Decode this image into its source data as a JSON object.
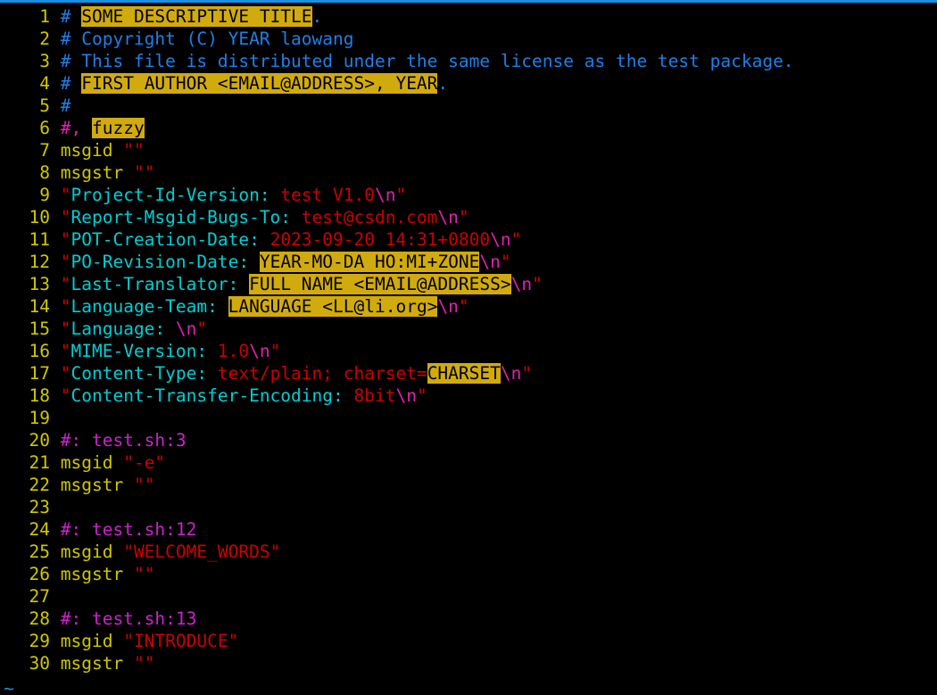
{
  "editor": {
    "name": "vim",
    "mode": "normal",
    "filetype": "po",
    "background_color": "#000000",
    "border_color": "#1a8fe3",
    "search_highlight_color": "#d1ab0e",
    "line_number_color": "#cfc800",
    "filler_char": "~"
  },
  "lines": [
    {
      "num": "1",
      "segments": [
        {
          "text": "#",
          "cls": "c-hash"
        },
        {
          "text": " ",
          "cls": "c-comment"
        },
        {
          "text": "SOME DESCRIPTIVE TITLE",
          "cls": "hl"
        },
        {
          "text": ".",
          "cls": "c-comment"
        }
      ]
    },
    {
      "num": "2",
      "segments": [
        {
          "text": "# Copyright (C) YEAR laowang",
          "cls": "c-comment"
        }
      ]
    },
    {
      "num": "3",
      "segments": [
        {
          "text": "# This file is distributed under the same license as the test package.",
          "cls": "c-comment"
        }
      ]
    },
    {
      "num": "4",
      "segments": [
        {
          "text": "#",
          "cls": "c-hash"
        },
        {
          "text": " ",
          "cls": "c-comment"
        },
        {
          "text": "FIRST AUTHOR <EMAIL@ADDRESS>, YEAR",
          "cls": "hl"
        },
        {
          "text": ".",
          "cls": "c-comment"
        }
      ]
    },
    {
      "num": "5",
      "segments": [
        {
          "text": "#",
          "cls": "c-hash"
        }
      ]
    },
    {
      "num": "6",
      "segments": [
        {
          "text": "#,",
          "cls": "c-flag"
        },
        {
          "text": " ",
          "cls": "c-comment"
        },
        {
          "text": "fuzzy",
          "cls": "hl"
        }
      ]
    },
    {
      "num": "7",
      "segments": [
        {
          "text": "msgid",
          "cls": "c-kw"
        },
        {
          "text": " ",
          "cls": "c-str"
        },
        {
          "text": "\"\"",
          "cls": "c-str"
        }
      ]
    },
    {
      "num": "8",
      "segments": [
        {
          "text": "msgstr",
          "cls": "c-kw"
        },
        {
          "text": " ",
          "cls": "c-str"
        },
        {
          "text": "\"\"",
          "cls": "c-str"
        }
      ]
    },
    {
      "num": "9",
      "segments": [
        {
          "text": "\"",
          "cls": "c-str"
        },
        {
          "text": "Project-Id-Version:",
          "cls": "c-hdr"
        },
        {
          "text": " ",
          "cls": "c-str"
        },
        {
          "text": "test V1.0",
          "cls": "c-str"
        },
        {
          "text": "\\n",
          "cls": "c-esc"
        },
        {
          "text": "\"",
          "cls": "c-str"
        }
      ]
    },
    {
      "num": "10",
      "segments": [
        {
          "text": "\"",
          "cls": "c-str"
        },
        {
          "text": "Report-Msgid-Bugs-To:",
          "cls": "c-hdr"
        },
        {
          "text": " ",
          "cls": "c-str"
        },
        {
          "text": "test@csdn.com",
          "cls": "c-str"
        },
        {
          "text": "\\n",
          "cls": "c-esc"
        },
        {
          "text": "\"",
          "cls": "c-str"
        }
      ]
    },
    {
      "num": "11",
      "segments": [
        {
          "text": "\"",
          "cls": "c-str"
        },
        {
          "text": "POT-Creation-Date:",
          "cls": "c-hdr"
        },
        {
          "text": " ",
          "cls": "c-str"
        },
        {
          "text": "2023-09-20 14:31+0800",
          "cls": "c-str"
        },
        {
          "text": "\\n",
          "cls": "c-esc"
        },
        {
          "text": "\"",
          "cls": "c-str"
        }
      ]
    },
    {
      "num": "12",
      "segments": [
        {
          "text": "\"",
          "cls": "c-str"
        },
        {
          "text": "PO-Revision-Date:",
          "cls": "c-hdr"
        },
        {
          "text": " ",
          "cls": "c-str"
        },
        {
          "text": "YEAR-MO-DA HO:MI+ZONE",
          "cls": "hl"
        },
        {
          "text": "\\n",
          "cls": "c-esc"
        },
        {
          "text": "\"",
          "cls": "c-str"
        }
      ]
    },
    {
      "num": "13",
      "segments": [
        {
          "text": "\"",
          "cls": "c-str"
        },
        {
          "text": "Last-Translator:",
          "cls": "c-hdr"
        },
        {
          "text": " ",
          "cls": "c-str"
        },
        {
          "text": "FULL NAME <EMAIL@ADDRESS>",
          "cls": "hl"
        },
        {
          "text": "\\n",
          "cls": "c-esc"
        },
        {
          "text": "\"",
          "cls": "c-str"
        }
      ]
    },
    {
      "num": "14",
      "segments": [
        {
          "text": "\"",
          "cls": "c-str"
        },
        {
          "text": "Language-Team:",
          "cls": "c-hdr"
        },
        {
          "text": " ",
          "cls": "c-str"
        },
        {
          "text": "LANGUAGE <LL@li.org>",
          "cls": "hl"
        },
        {
          "text": "\\n",
          "cls": "c-esc"
        },
        {
          "text": "\"",
          "cls": "c-str"
        }
      ]
    },
    {
      "num": "15",
      "segments": [
        {
          "text": "\"",
          "cls": "c-str"
        },
        {
          "text": "Language:",
          "cls": "c-hdr"
        },
        {
          "text": " ",
          "cls": "c-str"
        },
        {
          "text": "\\n",
          "cls": "c-esc"
        },
        {
          "text": "\"",
          "cls": "c-str"
        }
      ]
    },
    {
      "num": "16",
      "segments": [
        {
          "text": "\"",
          "cls": "c-str"
        },
        {
          "text": "MIME-Version:",
          "cls": "c-hdr"
        },
        {
          "text": " ",
          "cls": "c-str"
        },
        {
          "text": "1.0",
          "cls": "c-str"
        },
        {
          "text": "\\n",
          "cls": "c-esc"
        },
        {
          "text": "\"",
          "cls": "c-str"
        }
      ]
    },
    {
      "num": "17",
      "segments": [
        {
          "text": "\"",
          "cls": "c-str"
        },
        {
          "text": "Content-Type:",
          "cls": "c-hdr"
        },
        {
          "text": " ",
          "cls": "c-str"
        },
        {
          "text": "text/plain; charset=",
          "cls": "c-str"
        },
        {
          "text": "CHARSET",
          "cls": "hl"
        },
        {
          "text": "\\n",
          "cls": "c-esc"
        },
        {
          "text": "\"",
          "cls": "c-str"
        }
      ]
    },
    {
      "num": "18",
      "segments": [
        {
          "text": "\"",
          "cls": "c-str"
        },
        {
          "text": "Content-Transfer-Encoding:",
          "cls": "c-hdr"
        },
        {
          "text": " ",
          "cls": "c-str"
        },
        {
          "text": "8bit",
          "cls": "c-str"
        },
        {
          "text": "\\n",
          "cls": "c-esc"
        },
        {
          "text": "\"",
          "cls": "c-str"
        }
      ]
    },
    {
      "num": "19",
      "segments": []
    },
    {
      "num": "20",
      "segments": [
        {
          "text": "#:",
          "cls": "c-ref"
        },
        {
          "text": " ",
          "cls": "c-ref"
        },
        {
          "text": "test.sh:3",
          "cls": "c-ref"
        }
      ]
    },
    {
      "num": "21",
      "segments": [
        {
          "text": "msgid",
          "cls": "c-kw"
        },
        {
          "text": " ",
          "cls": "c-str"
        },
        {
          "text": "\"-e\"",
          "cls": "c-str"
        }
      ]
    },
    {
      "num": "22",
      "segments": [
        {
          "text": "msgstr",
          "cls": "c-kw"
        },
        {
          "text": " ",
          "cls": "c-str"
        },
        {
          "text": "\"\"",
          "cls": "c-str"
        }
      ]
    },
    {
      "num": "23",
      "segments": []
    },
    {
      "num": "24",
      "segments": [
        {
          "text": "#:",
          "cls": "c-ref"
        },
        {
          "text": " ",
          "cls": "c-ref"
        },
        {
          "text": "test.sh:12",
          "cls": "c-ref"
        }
      ]
    },
    {
      "num": "25",
      "segments": [
        {
          "text": "msgid",
          "cls": "c-kw"
        },
        {
          "text": " ",
          "cls": "c-str"
        },
        {
          "text": "\"WELCOME_WORDS\"",
          "cls": "c-str"
        }
      ]
    },
    {
      "num": "26",
      "segments": [
        {
          "text": "msgstr",
          "cls": "c-kw"
        },
        {
          "text": " ",
          "cls": "c-str"
        },
        {
          "text": "\"\"",
          "cls": "c-str"
        }
      ]
    },
    {
      "num": "27",
      "segments": []
    },
    {
      "num": "28",
      "segments": [
        {
          "text": "#:",
          "cls": "c-ref"
        },
        {
          "text": " ",
          "cls": "c-ref"
        },
        {
          "text": "test.sh:13",
          "cls": "c-ref"
        }
      ]
    },
    {
      "num": "29",
      "segments": [
        {
          "text": "msgid",
          "cls": "c-kw"
        },
        {
          "text": " ",
          "cls": "c-str"
        },
        {
          "text": "\"INTRODUCE\"",
          "cls": "c-str"
        }
      ]
    },
    {
      "num": "30",
      "segments": [
        {
          "text": "msgstr",
          "cls": "c-kw"
        },
        {
          "text": " ",
          "cls": "c-str"
        },
        {
          "text": "\"\"",
          "cls": "c-str"
        }
      ]
    }
  ]
}
